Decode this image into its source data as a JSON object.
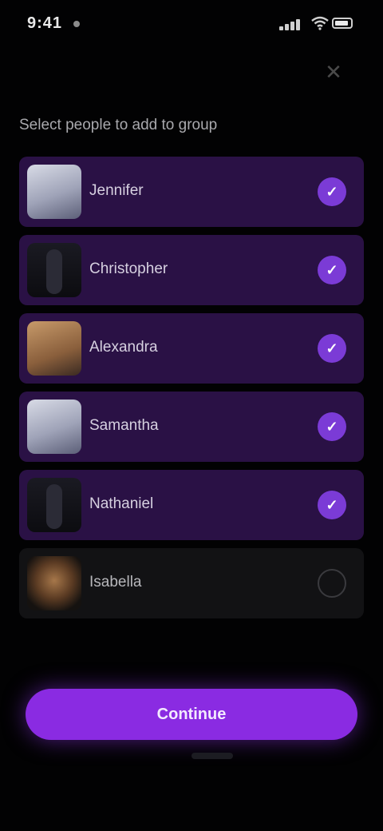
{
  "status_bar": {
    "time": "9:41"
  },
  "header": {
    "close_icon": "close-icon"
  },
  "section": {
    "title": "Select people to add to group"
  },
  "people": [
    {
      "name": "Jennifer",
      "selected": true,
      "avatar": "light"
    },
    {
      "name": "Christopher",
      "selected": true,
      "avatar": "dark"
    },
    {
      "name": "Alexandra",
      "selected": true,
      "avatar": "warm"
    },
    {
      "name": "Samantha",
      "selected": true,
      "avatar": "light"
    },
    {
      "name": "Nathaniel",
      "selected": true,
      "avatar": "dark"
    },
    {
      "name": "Isabella",
      "selected": false,
      "avatar": "warm-dark"
    }
  ],
  "actions": {
    "continue_label": "Continue"
  },
  "colors": {
    "background": "#020203",
    "selected_row": "#2a1145",
    "unselected_row": "#121214",
    "accent": "#8a2be2",
    "check": "#7b3bd6"
  }
}
